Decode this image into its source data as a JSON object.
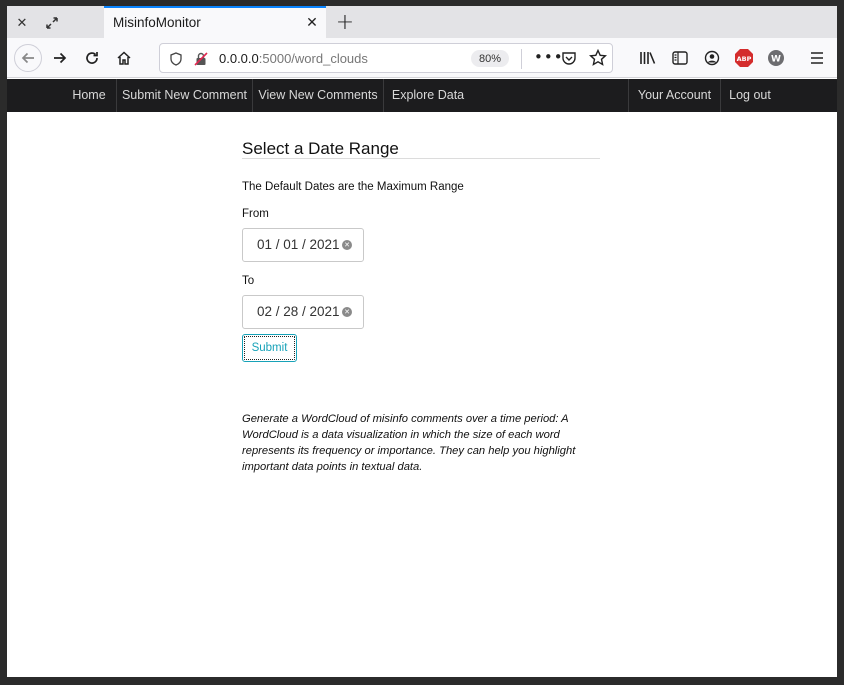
{
  "browser": {
    "tab_title": "MisinfoMonitor",
    "url_host": "0.0.0.0",
    "url_rest": ":5000/word_clouds",
    "zoom": "80%",
    "abp_label": "ABP",
    "w_label": "W"
  },
  "nav": {
    "items": [
      {
        "label": "Home"
      },
      {
        "label": "Submit New Comment"
      },
      {
        "label": "View New Comments"
      },
      {
        "label": "Explore Data"
      }
    ],
    "right_items": [
      {
        "label": "Your Account"
      },
      {
        "label": "Log out"
      }
    ]
  },
  "form": {
    "title": "Select a Date Range",
    "subtitle": "The Default Dates are the Maximum Range",
    "from_label": "From",
    "from_value": "01 / 01 / 2021",
    "to_label": "To",
    "to_value": "02 / 28 / 2021",
    "submit_label": "Submit"
  },
  "description": "Generate a WordCloud of misinfo comments over a time period: A WordCloud is a data visualization in which the size of each word represents its frequency or importance. They can help you highlight important data points in textual data.",
  "colors": {
    "accent": "#17a2b8",
    "nav_bg": "#1c1c1e",
    "tab_highlight": "#0a84ff"
  }
}
